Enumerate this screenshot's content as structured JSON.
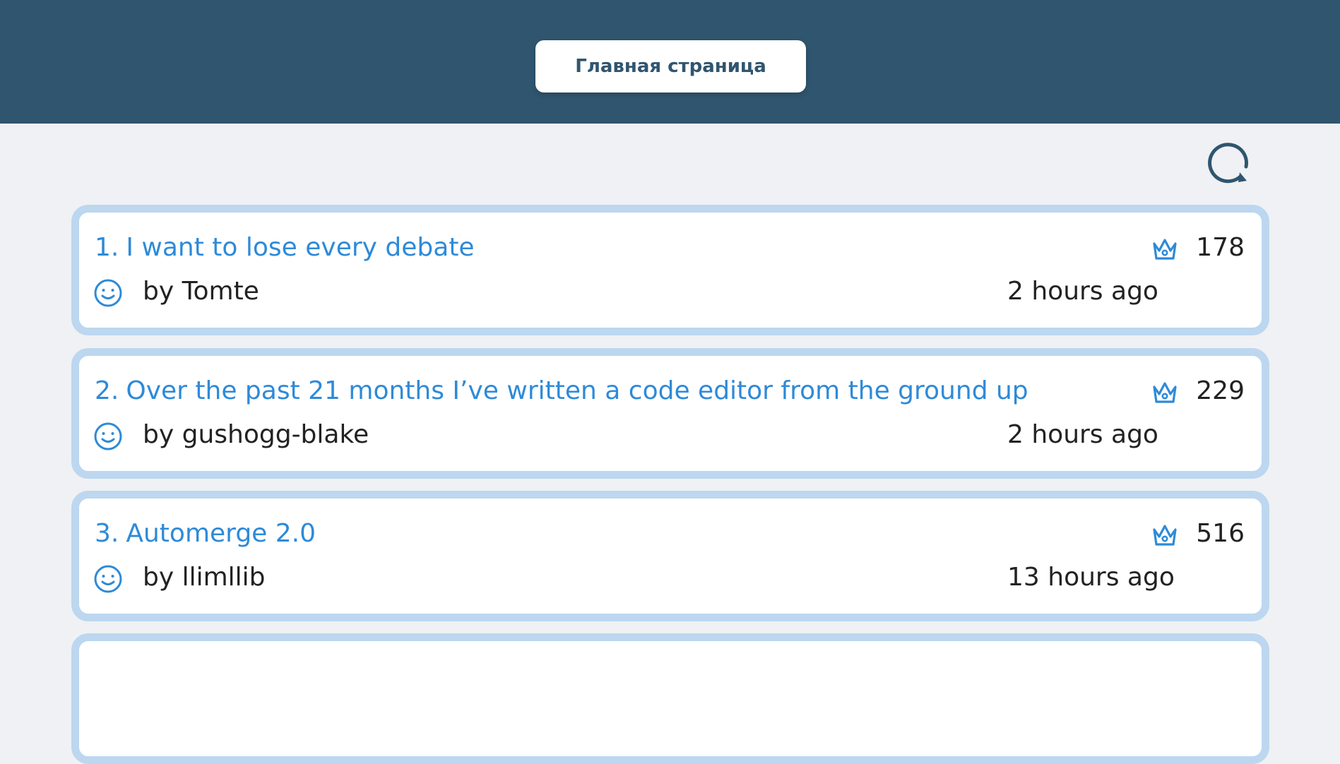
{
  "header": {
    "home_button_label": "Главная страница"
  },
  "toolbar": {
    "refresh_icon": "refresh-icon"
  },
  "posts": [
    {
      "number": "1.",
      "title": "I want to lose every debate",
      "author": "by Tomte",
      "time": "2 hours ago",
      "score": "178"
    },
    {
      "number": "2.",
      "title": "Over the past 21 months I’ve written a code editor from the ground up",
      "author": "by gushogg-blake",
      "time": "2 hours ago",
      "score": "229"
    },
    {
      "number": "3.",
      "title": "Automerge 2.0",
      "author": "by llimllib",
      "time": "13 hours ago",
      "score": "516"
    },
    {
      "number": "",
      "title": "",
      "author": "",
      "time": "",
      "score": ""
    }
  ],
  "colors": {
    "header_bg": "#30556f",
    "page_bg": "#eff1f4",
    "card_border": "#bcd7ef",
    "link": "#2e8ad8",
    "text": "#222222"
  },
  "icons": {
    "score": "crown-icon",
    "author": "smiley-user-icon"
  }
}
